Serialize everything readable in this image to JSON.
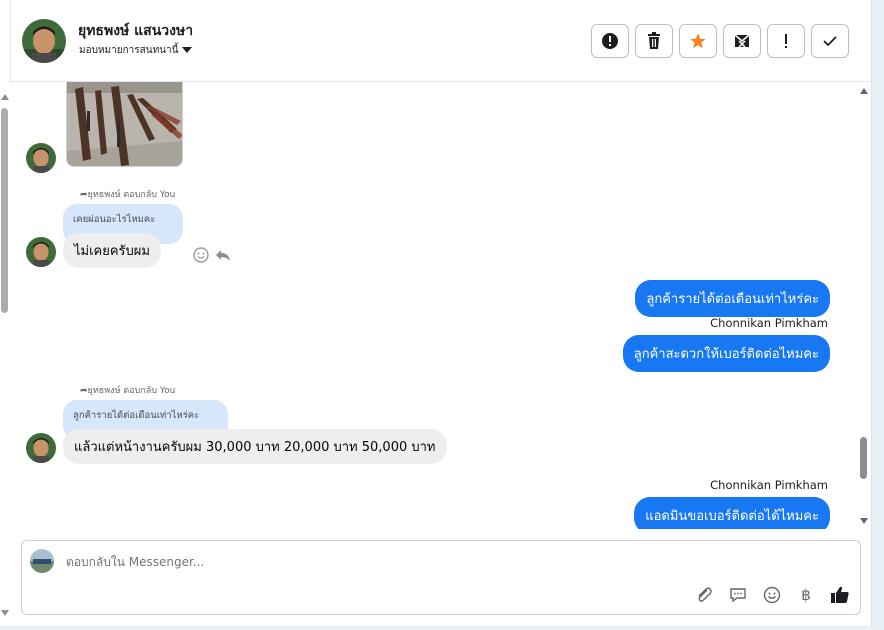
{
  "header": {
    "contact_name": "ยุทธพงษ์ แสนวงษา",
    "assign_label": "มอบหมายการสนทนานี้"
  },
  "actions": [
    {
      "name": "spam-button",
      "icon": "alert-circle-icon"
    },
    {
      "name": "delete-button",
      "icon": "trash-icon"
    },
    {
      "name": "star-button",
      "icon": "star-icon",
      "color": "#f5821f"
    },
    {
      "name": "mark-unread-button",
      "icon": "envelope-x-icon"
    },
    {
      "name": "important-button",
      "icon": "exclamation-icon"
    },
    {
      "name": "done-button",
      "icon": "check-icon"
    }
  ],
  "messages": {
    "reply1": {
      "label": "ยุทธพงษ์ ตอบกลับ You",
      "quoted": "เคยผ่อนอะไรไหมคะ",
      "text": "ไม่เคยครับผม"
    },
    "out1": "ลูกค้ารายได้ต่อเดือนเท่าไหร่คะ",
    "sender1": "Chonnikan Pimkham",
    "out2": "ลูกค้าสะดวกให้เบอร์ติดต่อไหมคะ",
    "reply2": {
      "label": "ยุทธพงษ์ ตอบกลับ You",
      "quoted": "ลูกค้ารายได้ต่อเดือนเท่าไหร่คะ",
      "text": "แล้วแต่หน้างานครับผม 30,000 บาท 20,000 บาท 50,000 บาท"
    },
    "sender2": "Chonnikan Pimkham",
    "out3": "แอดมินขอเบอร์ติดต่อได้ไหมคะ"
  },
  "composer": {
    "placeholder": "ตอบกลับใน Messenger...",
    "tools": [
      "paperclip-icon",
      "saved-reply-icon",
      "emoji-icon",
      "baht-icon",
      "thumbs-up-icon"
    ]
  },
  "colors": {
    "accent": "#1877f2",
    "incoming_bubble": "#eeeeee",
    "quoted_bubble": "#d6e6fb",
    "star": "#f5821f"
  }
}
